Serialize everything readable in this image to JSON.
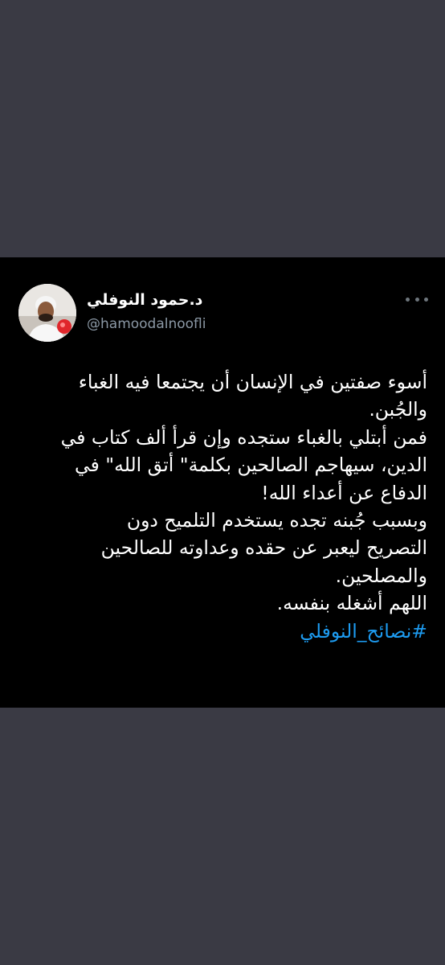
{
  "tweet": {
    "author": {
      "display_name": "د.حمود النوفلي",
      "handle": "@hamoodalnoofli"
    },
    "more_icon": "more-dots-icon",
    "lines": [
      "أسوء صفتين في الإنسان أن يجتمعا فيه الغباء",
      "والجُبن.",
      "فمن أبتلي بالغباء ستجده وإن قرأ ألف كتاب في",
      "الدين، سيهاجم الصالحين بكلمة\" أتق الله\" في",
      "الدفاع عن أعداء الله!",
      "وبسبب جُبنه تجده يستخدم التلميح دون",
      "التصريح ليعبر عن حقده وعداوته للصالحين",
      "والمصلحين.",
      "اللهم أشغله بنفسه."
    ],
    "hashtag": "#نصائح_النوفلي"
  },
  "colors": {
    "background": "#3a3a44",
    "card": "#000000",
    "text": "#ffffff",
    "muted": "#8b98a5",
    "link": "#1d9bf0"
  }
}
